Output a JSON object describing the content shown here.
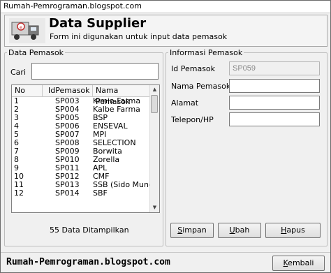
{
  "window": {
    "title": "Rumah-Pemrograman.blogspot.com"
  },
  "header": {
    "logo_icon": "truck-icon",
    "title": "Data Supplier",
    "subtitle": "Form ini digunakan untuk input data pemasok"
  },
  "left_panel": {
    "legend": "Data Pemasok",
    "search_label": "Cari",
    "search_value": "",
    "table": {
      "columns": [
        "No",
        "IdPemasok",
        "Nama Pemasok"
      ],
      "rows": [
        [
          "1",
          "SP003",
          "Kimia Farma"
        ],
        [
          "2",
          "SP004",
          "Kalbe Farma"
        ],
        [
          "3",
          "SP005",
          "BSP"
        ],
        [
          "4",
          "SP006",
          "ENSEVAL"
        ],
        [
          "5",
          "SP007",
          "MPI"
        ],
        [
          "6",
          "SP008",
          "SELECTION"
        ],
        [
          "7",
          "SP009",
          "Borwita"
        ],
        [
          "8",
          "SP010",
          "Zorella"
        ],
        [
          "9",
          "SP011",
          "APL"
        ],
        [
          "10",
          "SP012",
          "CMF"
        ],
        [
          "11",
          "SP013",
          "SSB (Sido Muncul)"
        ],
        [
          "12",
          "SP014",
          "SBF"
        ]
      ]
    },
    "count_text": "55 Data Ditampilkan"
  },
  "right_panel": {
    "legend": "Informasi Pemasok",
    "fields": {
      "id_label": "Id Pemasok",
      "id_value": "SP059",
      "nama_label": "Nama Pemasok",
      "nama_value": "",
      "alamat_label": "Alamat",
      "alamat_value": "",
      "telepon_label": "Telepon/HP",
      "telepon_value": ""
    },
    "buttons": {
      "simpan_key": "S",
      "simpan_rest": "impan",
      "ubah_key": "U",
      "ubah_rest": "bah",
      "hapus_key": "H",
      "hapus_rest": "apus"
    }
  },
  "footer": {
    "site": "Rumah-Pemrograman.blogspot.com",
    "kembali_key": "K",
    "kembali_rest": "embali"
  }
}
